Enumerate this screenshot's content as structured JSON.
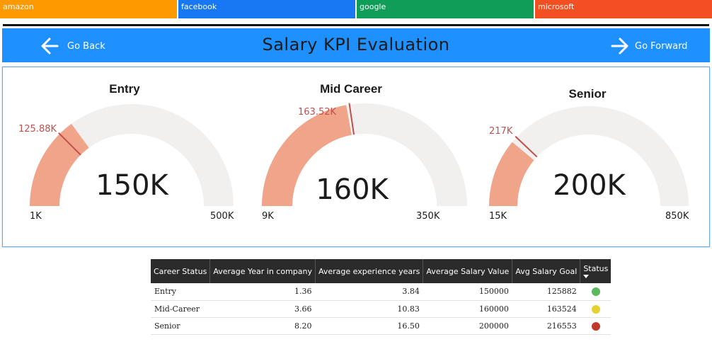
{
  "tabs": [
    {
      "label": "amazon",
      "color": "#ff9900"
    },
    {
      "label": "facebook",
      "color": "#1877f2"
    },
    {
      "label": "google",
      "color": "#0f9d58"
    },
    {
      "label": "microsoft",
      "color": "#f25022"
    }
  ],
  "header": {
    "title": "Salary KPI Evaluation",
    "back_label": "Go Back",
    "forward_label": "Go Forward",
    "color": "#1e90ff"
  },
  "gauges": [
    {
      "title": "Entry",
      "value": 150000,
      "value_label": "150K",
      "min": 1000,
      "min_label": "1K",
      "max": 500000,
      "max_label": "500K",
      "target": 125882,
      "target_label": "125.88K"
    },
    {
      "title": "Mid Career",
      "value": 160000,
      "value_label": "160K",
      "min": 9000,
      "min_label": "9K",
      "max": 350000,
      "max_label": "350K",
      "target": 163524,
      "target_label": "163.52K"
    },
    {
      "title": "Senior",
      "value": 200000,
      "value_label": "200K",
      "min": 15000,
      "min_label": "15K",
      "max": 850000,
      "max_label": "850K",
      "target": 216553,
      "target_label": "217K"
    }
  ],
  "gauge_colors": {
    "fill": "#f0a58a",
    "track": "#f1f0ef",
    "target": "#c0504d"
  },
  "table": {
    "columns": [
      "Career Status",
      "Average Year in company",
      "Average experience years",
      "Average Salary Value",
      "Avg Salary Goal",
      "Status"
    ],
    "rows": [
      {
        "status": "Entry",
        "years_company": "1.36",
        "years_exp": "3.84",
        "salary": "150000",
        "goal": "125882",
        "status_color": "#5cb85c"
      },
      {
        "status": "Mid-Career",
        "years_company": "3.66",
        "years_exp": "10.83",
        "salary": "160000",
        "goal": "163524",
        "status_color": "#e6d130"
      },
      {
        "status": "Senior",
        "years_company": "8.20",
        "years_exp": "16.50",
        "salary": "200000",
        "goal": "216553",
        "status_color": "#c0392b"
      }
    ]
  }
}
